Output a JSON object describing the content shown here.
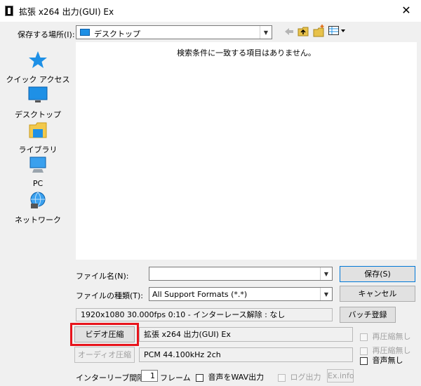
{
  "window": {
    "title": "拡張 x264 出力(GUI) Ex",
    "close_glyph": "✕"
  },
  "location": {
    "label": "保存する場所(I):",
    "value": "デスクトップ"
  },
  "toolbar": {
    "back_icon": "back-arrow-icon",
    "up_icon": "up-folder-icon",
    "new_icon": "new-folder-icon",
    "view_icon": "view-menu-icon"
  },
  "file_list": {
    "empty_message": "検索条件に一致する項目はありません。"
  },
  "places": [
    {
      "label": "クイック アクセス",
      "icon": "star-icon"
    },
    {
      "label": "デスクトップ",
      "icon": "desktop-icon"
    },
    {
      "label": "ライブラリ",
      "icon": "library-icon"
    },
    {
      "label": "PC",
      "icon": "pc-icon"
    },
    {
      "label": "ネットワーク",
      "icon": "network-icon"
    }
  ],
  "filename": {
    "label": "ファイル名(N):",
    "value": ""
  },
  "filetype": {
    "label": "ファイルの種類(T):",
    "value": "All Support Formats (*.*)"
  },
  "buttons": {
    "save": "保存(S)",
    "cancel": "キャンセル",
    "batch": "バッチ登録"
  },
  "info_line": "1920x1080  30.000fps  0:10  -  インターレース解除 : なし",
  "video": {
    "button": "ビデオ圧縮",
    "field": "拡張 x264 出力(GUI) Ex",
    "no_recompress": "再圧縮無し"
  },
  "audio": {
    "button": "オーディオ圧縮",
    "field": "PCM 44.100kHz 2ch",
    "no_recompress": "再圧縮無し",
    "no_audio": "音声無し"
  },
  "interleave": {
    "label": "インターリーブ間隔 :",
    "value": "1",
    "unit": "フレーム"
  },
  "wav_output": "音声をWAV出力",
  "log_output": "ログ出力",
  "exinfo_button": "Ex.info",
  "colors": {
    "highlight": "#e8141c",
    "accent": "#1e90e6"
  }
}
